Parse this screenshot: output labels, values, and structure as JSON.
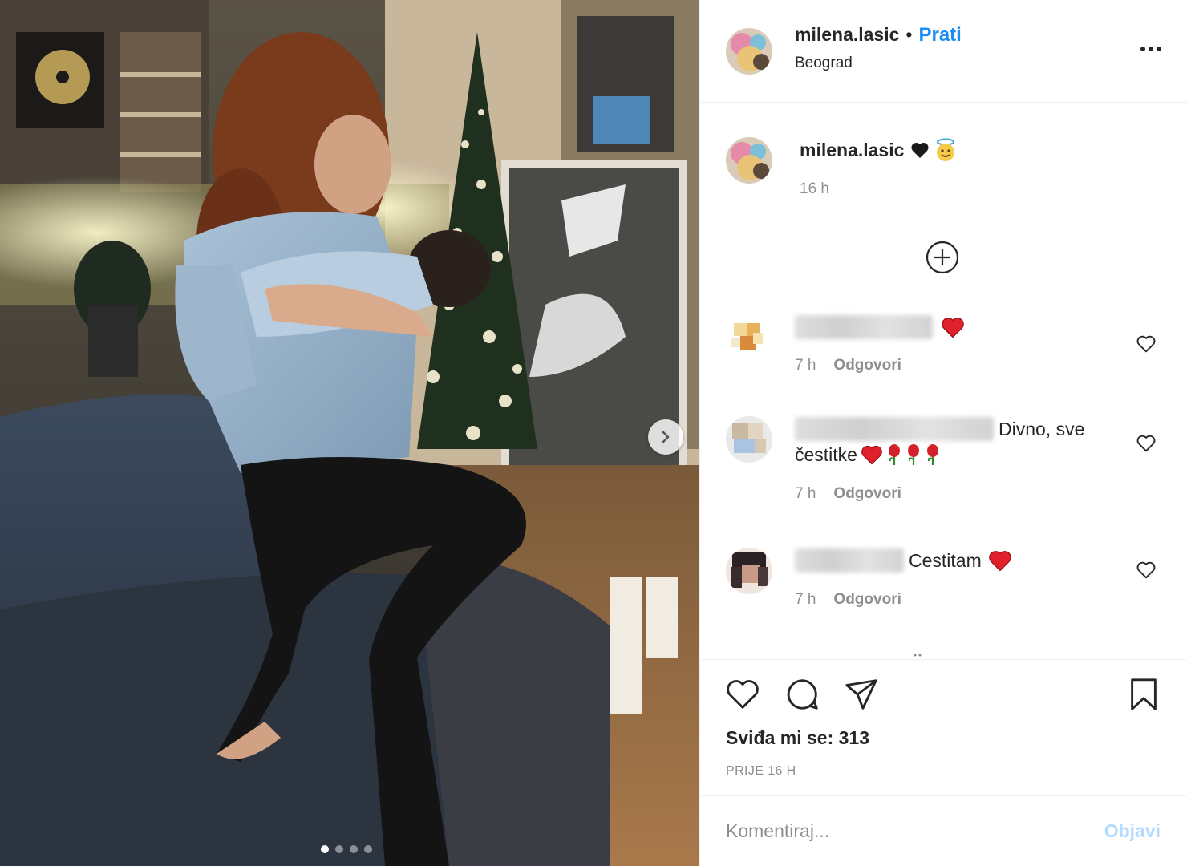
{
  "post": {
    "author": {
      "username": "milena.lasic",
      "location": "Beograd"
    },
    "follow_label": "Prati",
    "separator": "•",
    "caption": {
      "username": "milena.lasic",
      "emojis": [
        "black-heart",
        "angel-face"
      ],
      "time": "16 h"
    },
    "comments": [
      {
        "text": "",
        "emojis": [
          "red-heart"
        ],
        "time": "7 h",
        "reply_label": "Odgovori"
      },
      {
        "text_line1": "Divno, sve",
        "text_line2": "čestitke",
        "emojis": [
          "red-heart",
          "rose",
          "rose",
          "rose"
        ],
        "time": "7 h",
        "reply_label": "Odgovori"
      },
      {
        "text": "Cestitam",
        "emojis": [
          "red-heart"
        ],
        "time": "7 h",
        "reply_label": "Odgovori"
      }
    ],
    "likes_text": "Sviđa mi se: 313",
    "time_ago": "PRIJE 16 H",
    "comment_placeholder": "Komentiraj...",
    "post_button_label": "Objavi",
    "carousel": {
      "count": 4,
      "active_index": 0
    }
  },
  "icons": {
    "more": "more-options-icon",
    "next": "chevron-right-icon",
    "load_more": "plus-circle-icon",
    "like": "heart-outline-icon",
    "comment": "speech-bubble-icon",
    "share": "paper-plane-icon",
    "save": "bookmark-icon"
  },
  "colors": {
    "link_blue": "#1a8df2",
    "disabled_blue": "#b3dbff",
    "secondary_text": "#8e8e8e",
    "border": "#efefef"
  }
}
